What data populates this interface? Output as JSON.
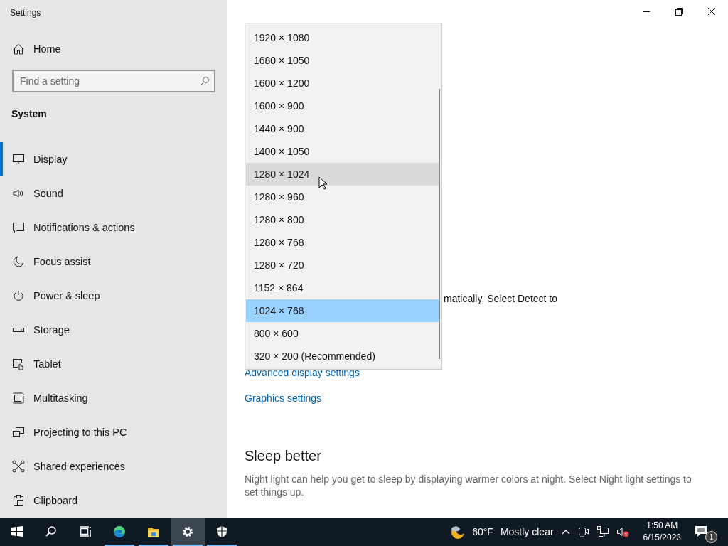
{
  "window": {
    "title": "Settings"
  },
  "sidebar": {
    "home": "Home",
    "search": {
      "placeholder": "Find a setting"
    },
    "section": "System",
    "items": [
      {
        "label": "Display",
        "selected": true
      },
      {
        "label": "Sound",
        "selected": false
      },
      {
        "label": "Notifications & actions",
        "selected": false
      },
      {
        "label": "Focus assist",
        "selected": false
      },
      {
        "label": "Power & sleep",
        "selected": false
      },
      {
        "label": "Storage",
        "selected": false
      },
      {
        "label": "Tablet",
        "selected": false
      },
      {
        "label": "Multitasking",
        "selected": false
      },
      {
        "label": "Projecting to this PC",
        "selected": false
      },
      {
        "label": "Shared experiences",
        "selected": false
      },
      {
        "label": "Clipboard",
        "selected": false
      }
    ]
  },
  "resolution_dropdown": {
    "options": [
      {
        "label": "1920 × 1080",
        "selected": false,
        "hovered": false
      },
      {
        "label": "1680 × 1050",
        "selected": false,
        "hovered": false
      },
      {
        "label": "1600 × 1200",
        "selected": false,
        "hovered": false
      },
      {
        "label": "1600 × 900",
        "selected": false,
        "hovered": false
      },
      {
        "label": "1440 × 900",
        "selected": false,
        "hovered": false
      },
      {
        "label": "1400 × 1050",
        "selected": false,
        "hovered": false
      },
      {
        "label": "1280 × 1024",
        "selected": false,
        "hovered": true
      },
      {
        "label": "1280 × 960",
        "selected": false,
        "hovered": false
      },
      {
        "label": "1280 × 800",
        "selected": false,
        "hovered": false
      },
      {
        "label": "1280 × 768",
        "selected": false,
        "hovered": false
      },
      {
        "label": "1280 × 720",
        "selected": false,
        "hovered": false
      },
      {
        "label": "1152 × 864",
        "selected": false,
        "hovered": false
      },
      {
        "label": "1024 × 768",
        "selected": true,
        "hovered": false
      },
      {
        "label": "800 × 600",
        "selected": false,
        "hovered": false
      },
      {
        "label": "320 × 200 (Recommended)",
        "selected": false,
        "hovered": false
      }
    ]
  },
  "content": {
    "covered_text": "matically. Select Detect to",
    "links": [
      "Advanced display settings",
      "Graphics settings"
    ],
    "heading": "Sleep better",
    "paragraph": "Night light can help you get to sleep by displaying warmer colors at night. Select Night light settings to set things up."
  },
  "taskbar": {
    "apps": [
      {
        "running": false,
        "active": false
      },
      {
        "running": false,
        "active": false
      },
      {
        "running": false,
        "active": false
      },
      {
        "running": true,
        "active": false
      },
      {
        "running": true,
        "active": false
      },
      {
        "running": true,
        "active": true
      },
      {
        "running": true,
        "active": false
      }
    ],
    "temperature": "60°F",
    "weather": "Mostly clear",
    "time": "1:50 AM",
    "date": "6/15/2023",
    "notifications": "1"
  }
}
